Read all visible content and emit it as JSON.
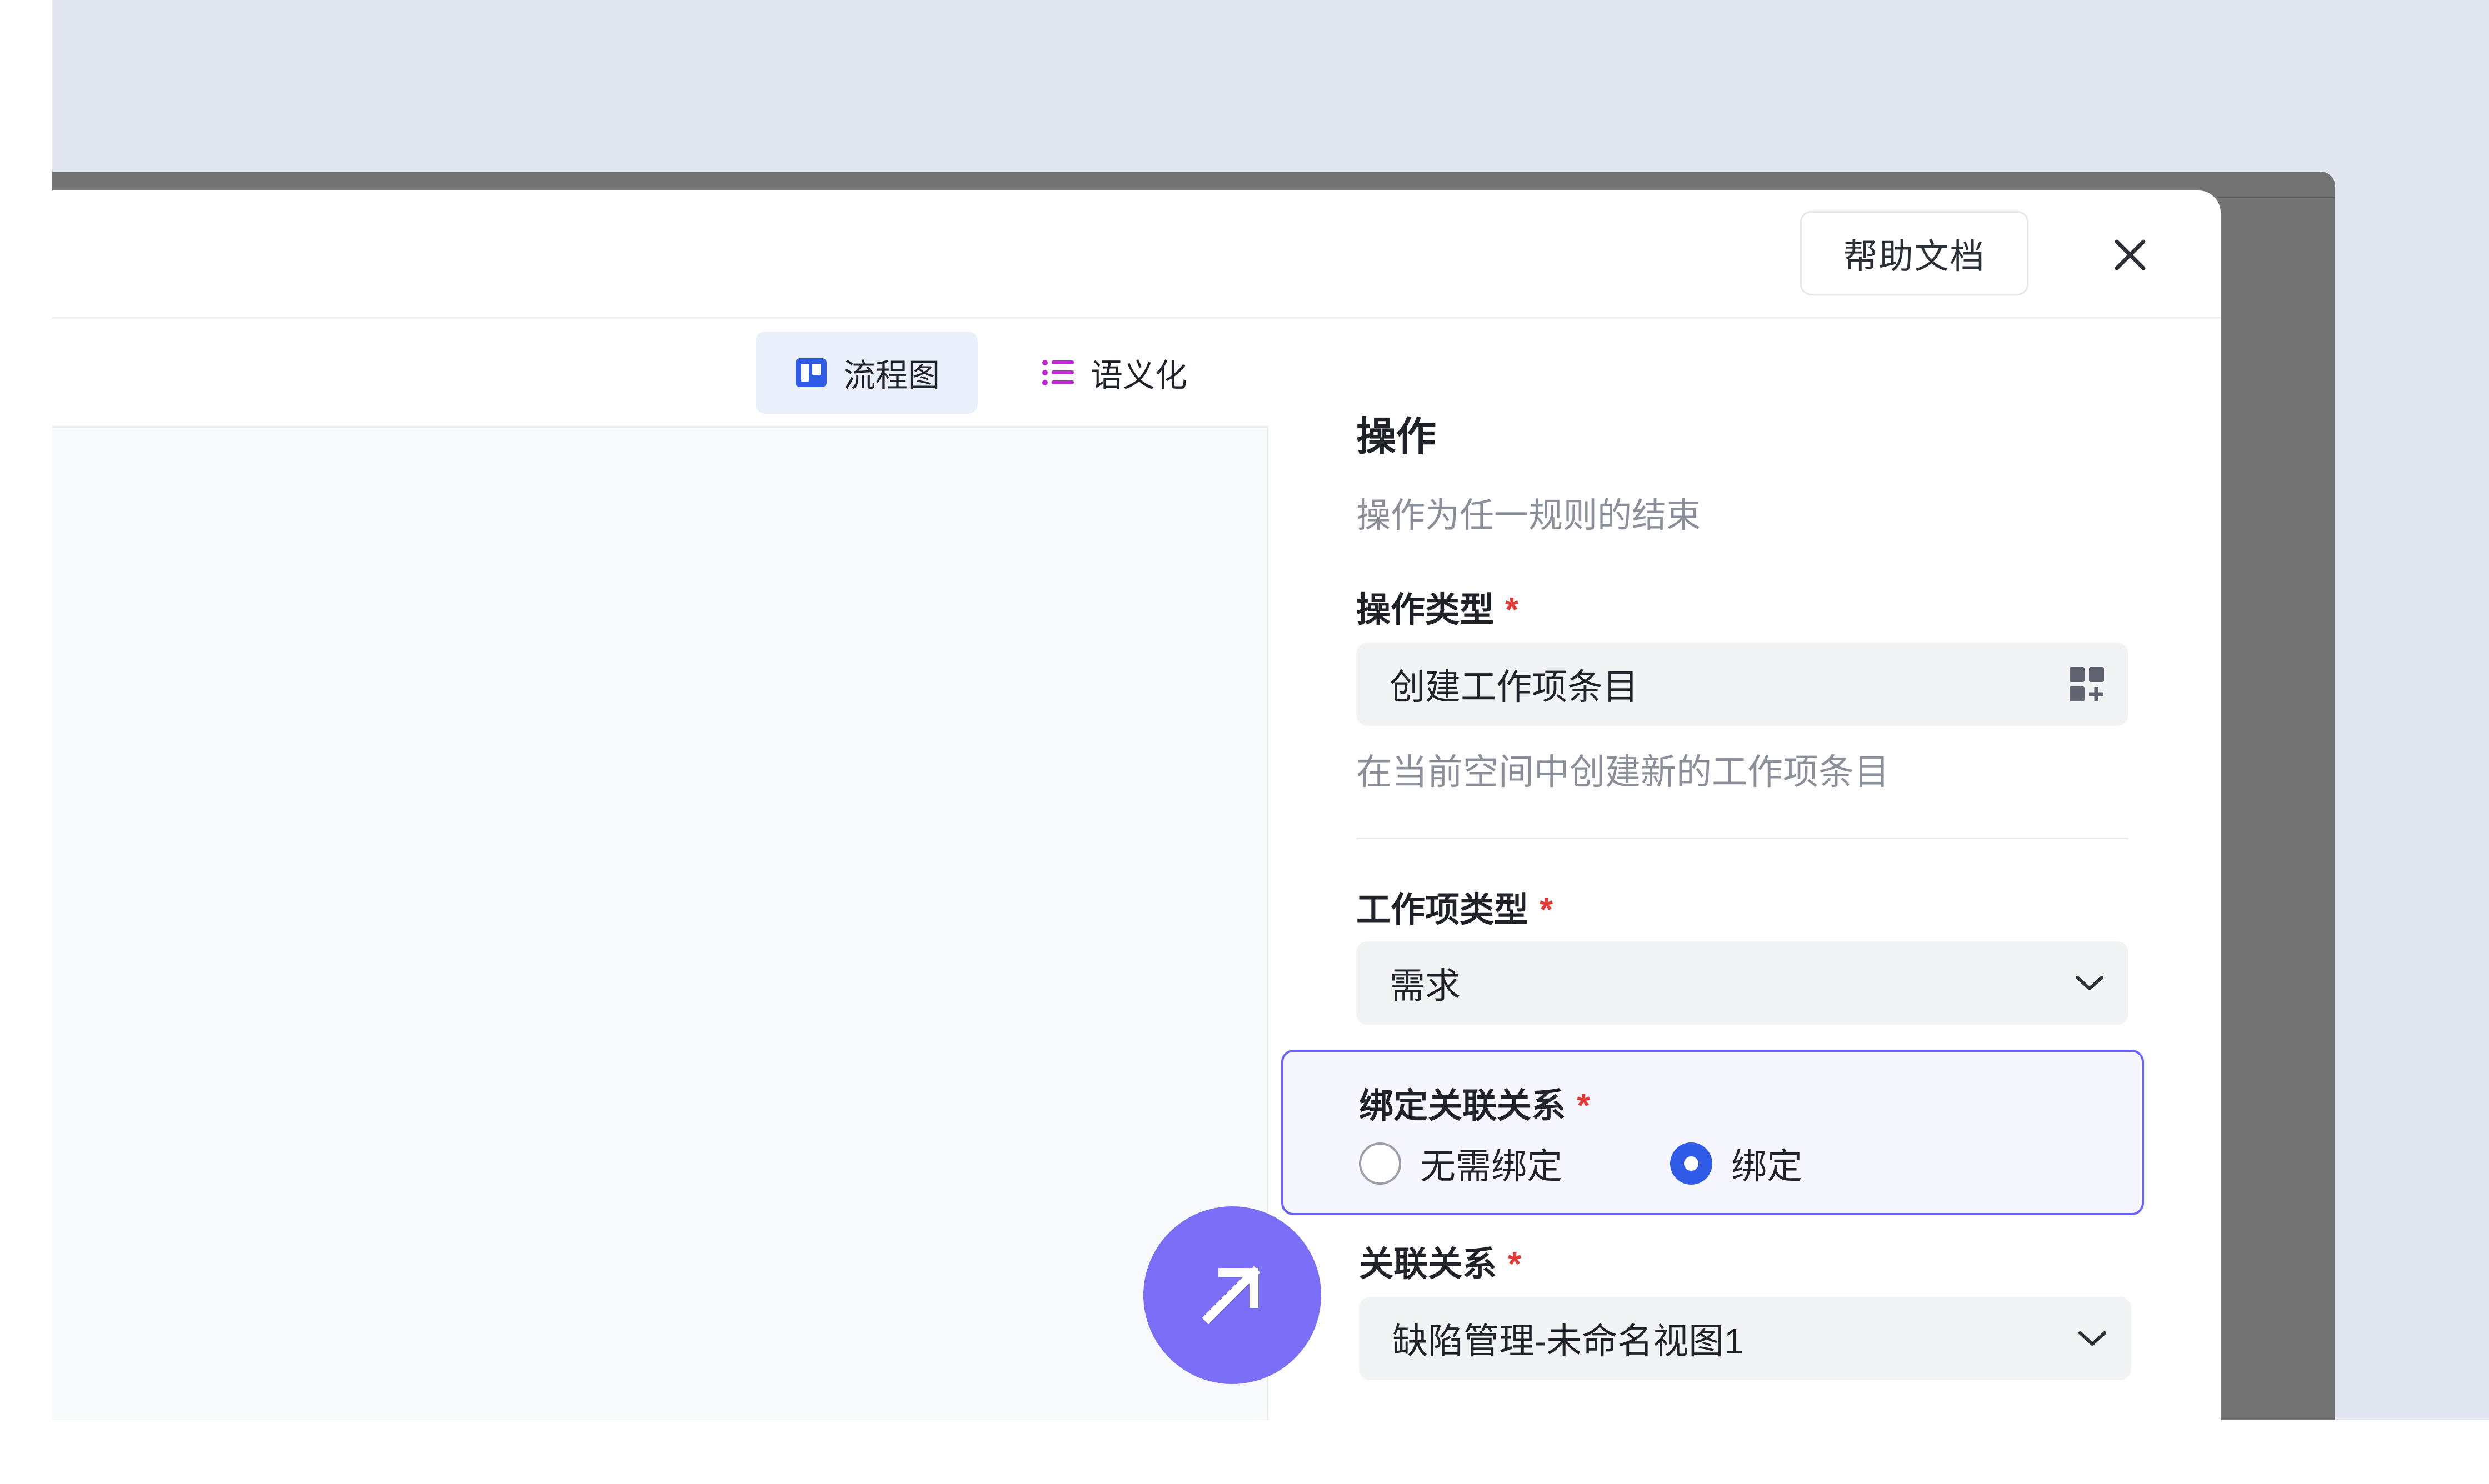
{
  "header": {
    "help_label": "帮助文档",
    "close_icon": "close-icon"
  },
  "toolbar": {
    "tabs": [
      {
        "label": "流程图",
        "icon": "flowchart-icon",
        "active": true
      },
      {
        "label": "语义化",
        "icon": "list-icon",
        "active": false
      }
    ]
  },
  "panel": {
    "title": "操作",
    "description": "操作为任一规则的结束",
    "action_type": {
      "label": "操作类型",
      "required_mark": "*",
      "value": "创建工作项条目",
      "icon": "grid-add-icon",
      "hint": "在当前空间中创建新的工作项条目"
    },
    "work_item_type": {
      "label": "工作项类型",
      "required_mark": "*",
      "value": "需求",
      "icon": "chevron-down-icon"
    },
    "bind_relation": {
      "label": "绑定关联关系",
      "required_mark": "*",
      "options": [
        {
          "label": "无需绑定",
          "selected": false
        },
        {
          "label": "绑定",
          "selected": true
        }
      ]
    },
    "relation": {
      "label": "关联关系",
      "required_mark": "*",
      "value": "缺陷管理-未命名视图1",
      "icon": "chevron-down-icon"
    }
  },
  "fab": {
    "icon": "arrow-up-right-icon"
  },
  "colors": {
    "accent": "#2f5be7",
    "highlight_border": "#6c63ff",
    "fab": "#7b6ef6",
    "required": "#e53935",
    "semantic_icon": "#c026d3"
  }
}
